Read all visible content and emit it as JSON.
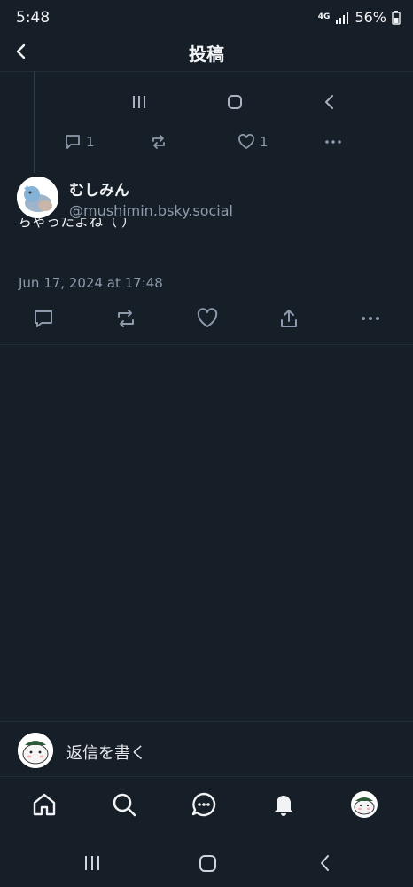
{
  "status_bar": {
    "time": "5:48",
    "network": "4G",
    "battery": "56%"
  },
  "header": {
    "title": "投稿",
    "back_icon": "chevron-left-icon"
  },
  "parent_post": {
    "reply_count": "1",
    "like_count": "1"
  },
  "post": {
    "author_display_name": "むしみん",
    "author_handle": "@mushimin.bsky.social",
    "text_partial": "ちゃったよね（  ）",
    "date": "Jun 17, 2024 at 17:48"
  },
  "compose": {
    "placeholder": "返信を書く"
  },
  "bottom_nav": {
    "items": [
      "home-icon",
      "search-icon",
      "chat-icon",
      "notifications-icon",
      "profile-avatar"
    ]
  },
  "colors": {
    "background": "#161e27",
    "text": "#f1f3f5",
    "muted": "#8d9aab",
    "divider": "#222c37",
    "thread_line": "#2d3a48"
  }
}
